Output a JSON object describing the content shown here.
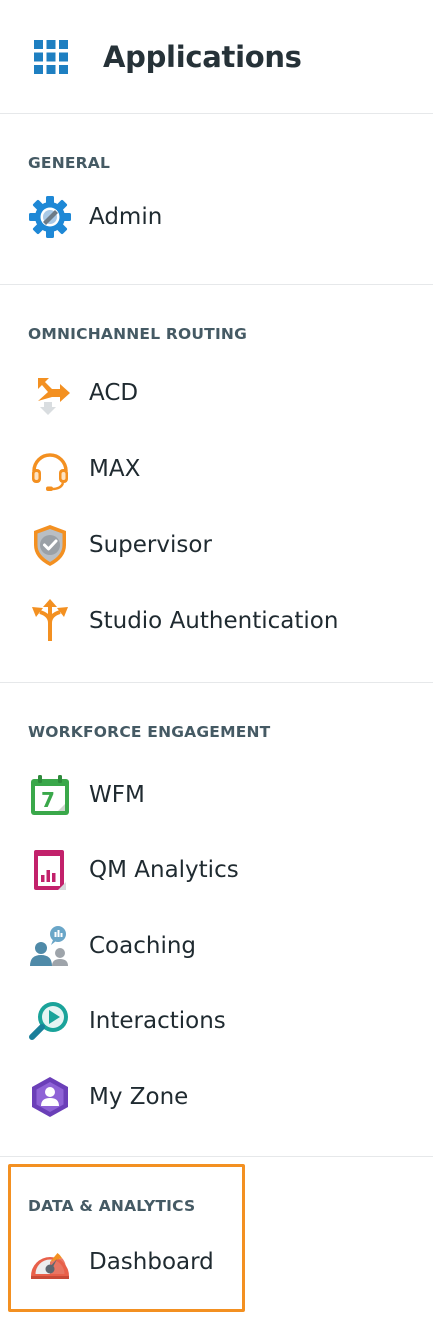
{
  "header": {
    "title": "Applications",
    "icon": "app-grid-icon"
  },
  "sections": {
    "general": {
      "title": "GENERAL",
      "items": [
        {
          "label": "Admin",
          "icon": "gear-icon"
        }
      ]
    },
    "omnichannel": {
      "title": "OMNICHANNEL ROUTING",
      "items": [
        {
          "label": "ACD",
          "icon": "routing-arrows-icon"
        },
        {
          "label": "MAX",
          "icon": "headset-icon"
        },
        {
          "label": "Supervisor",
          "icon": "shield-check-icon"
        },
        {
          "label": "Studio Authentication",
          "icon": "split-arrows-icon"
        }
      ]
    },
    "workforce": {
      "title": "WORKFORCE ENGAGEMENT",
      "items": [
        {
          "label": "WFM",
          "icon": "calendar-icon",
          "calendar_day": "7"
        },
        {
          "label": "QM Analytics",
          "icon": "report-chart-icon"
        },
        {
          "label": "Coaching",
          "icon": "coaching-people-icon"
        },
        {
          "label": "Interactions",
          "icon": "play-magnifier-icon"
        },
        {
          "label": "My Zone",
          "icon": "user-hexagon-icon"
        }
      ]
    },
    "data": {
      "title": "DATA & ANALYTICS",
      "items": [
        {
          "label": "Dashboard",
          "icon": "speedometer-icon"
        }
      ]
    }
  },
  "colors": {
    "highlight": "#f39021",
    "accent_blue": "#1e7fc1",
    "orange": "#f39021"
  }
}
